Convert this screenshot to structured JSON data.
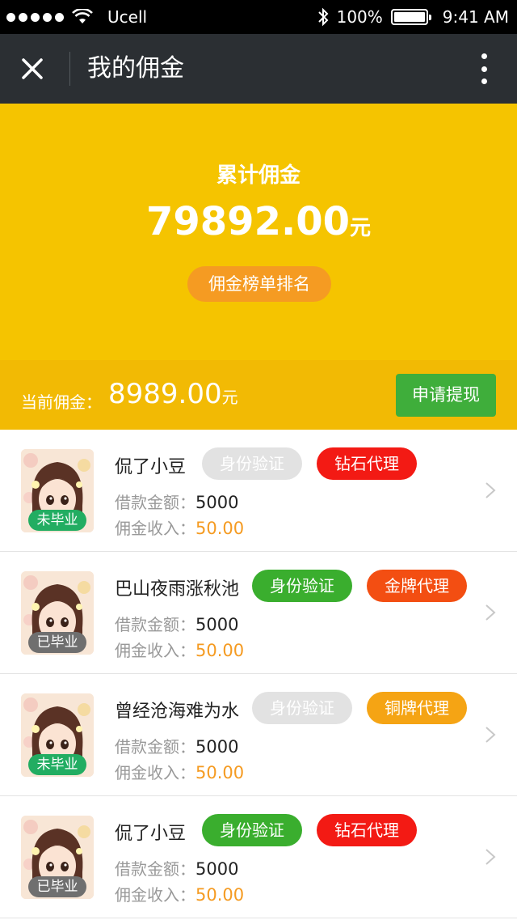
{
  "status_bar": {
    "carrier": "Ucell",
    "battery_percent": "100%",
    "time": "9:41 AM",
    "battery_level": 1.0
  },
  "nav": {
    "title": "我的佣金",
    "close_icon": "close-icon",
    "more_icon": "more-vertical-icon"
  },
  "summary": {
    "total_label": "累计佣金",
    "total_value": "79892.00",
    "total_unit": "元",
    "rank_button": "佣金榜单排名",
    "current_label": "当前佣金：",
    "current_value": "8989.00",
    "current_unit": "元",
    "withdraw_button": "申请提现"
  },
  "colors": {
    "header_yellow": "#f5c400",
    "current_bar_yellow": "#f2ba04",
    "rank_orange": "#f59b22",
    "withdraw_green": "#3fae3b",
    "nav_dark": "#2b2f33"
  },
  "list": {
    "items": [
      {
        "name": "侃了小豆",
        "grad_status": "未毕业",
        "grad_color": "green",
        "id_tag": "身份验证",
        "id_tag_style": "gray",
        "level_tag": "钻石代理",
        "level_tag_style": "red",
        "loan_label": "借款金额：",
        "loan_value": "5000",
        "income_label": "佣金收入：",
        "income_value": "50.00"
      },
      {
        "name": "巴山夜雨涨秋池",
        "grad_status": "已毕业",
        "grad_color": "gray",
        "id_tag": "身份验证",
        "id_tag_style": "green",
        "level_tag": "金牌代理",
        "level_tag_style": "orange-red",
        "loan_label": "借款金额：",
        "loan_value": "5000",
        "income_label": "佣金收入：",
        "income_value": "50.00"
      },
      {
        "name": "曾经沧海难为水",
        "grad_status": "未毕业",
        "grad_color": "green",
        "id_tag": "身份验证",
        "id_tag_style": "gray",
        "level_tag": "铜牌代理",
        "level_tag_style": "orange",
        "loan_label": "借款金额：",
        "loan_value": "5000",
        "income_label": "佣金收入：",
        "income_value": "50.00"
      },
      {
        "name": "侃了小豆",
        "grad_status": "已毕业",
        "grad_color": "gray",
        "id_tag": "身份验证",
        "id_tag_style": "green",
        "level_tag": "钻石代理",
        "level_tag_style": "red",
        "loan_label": "借款金额：",
        "loan_value": "5000",
        "income_label": "佣金收入：",
        "income_value": "50.00"
      }
    ]
  }
}
